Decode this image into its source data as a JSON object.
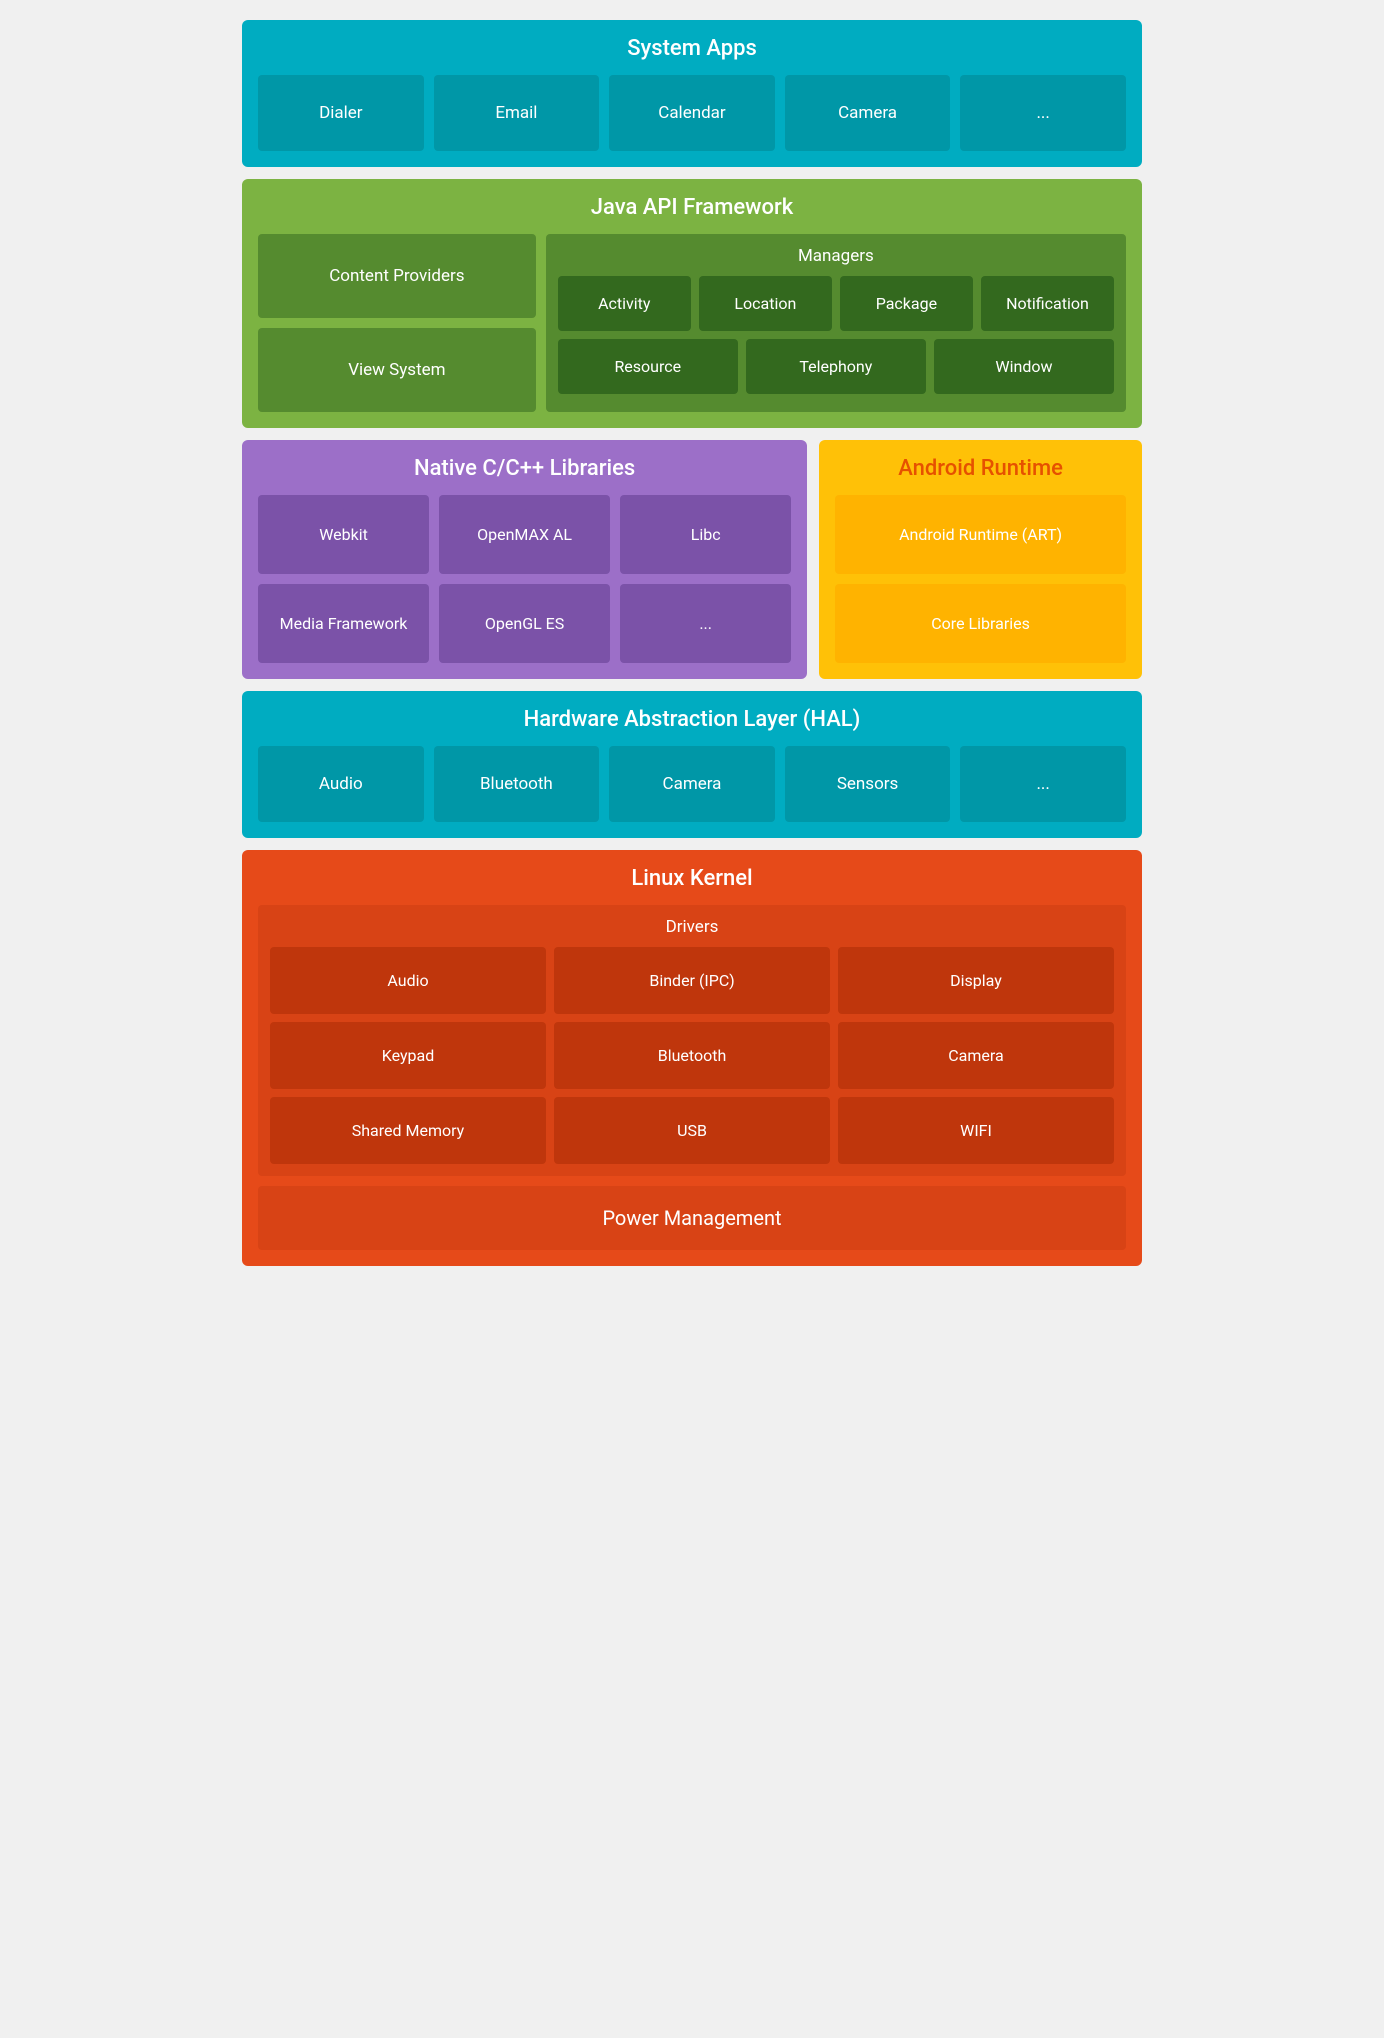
{
  "systemApps": {
    "title": "System Apps",
    "cards": [
      "Dialer",
      "Email",
      "Calendar",
      "Camera",
      "..."
    ]
  },
  "javaAPI": {
    "title": "Java API Framework",
    "leftCards": [
      "Content Providers",
      "View System"
    ],
    "managers": {
      "title": "Managers",
      "row1": [
        "Activity",
        "Location",
        "Package",
        "Notification"
      ],
      "row2": [
        "Resource",
        "Telephony",
        "Window"
      ]
    }
  },
  "nativeLibs": {
    "title": "Native C/C++ Libraries",
    "cards": [
      "Webkit",
      "OpenMAX AL",
      "Libc",
      "Media Framework",
      "OpenGL ES",
      "..."
    ]
  },
  "androidRuntime": {
    "title": "Android Runtime",
    "cards": [
      "Android Runtime (ART)",
      "Core Libraries"
    ]
  },
  "hal": {
    "title": "Hardware Abstraction Layer (HAL)",
    "cards": [
      "Audio",
      "Bluetooth",
      "Camera",
      "Sensors",
      "..."
    ]
  },
  "linuxKernel": {
    "title": "Linux Kernel",
    "drivers": {
      "title": "Drivers",
      "row1": [
        "Audio",
        "Binder (IPC)",
        "Display"
      ],
      "row2": [
        "Keypad",
        "Bluetooth",
        "Camera"
      ],
      "row3": [
        "Shared Memory",
        "USB",
        "WIFI"
      ]
    },
    "powerManagement": "Power Management"
  }
}
